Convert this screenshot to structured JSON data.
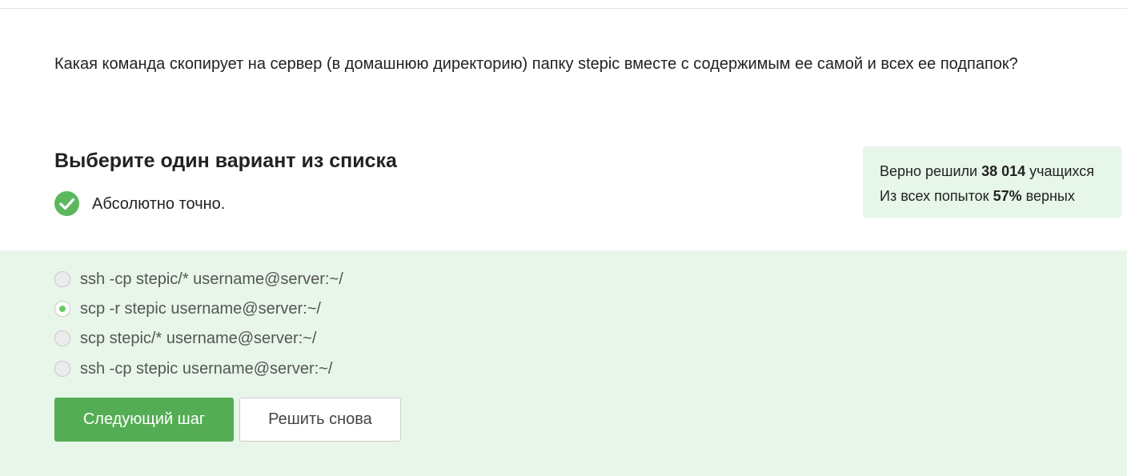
{
  "question": {
    "text": "Какая команда скопирует на сервер (в домашнюю директорию) папку stepic вместе с содержимым ее самой и всех ее подпапок?"
  },
  "instruction": "Выберите один вариант из списка",
  "feedback": {
    "text": "Абсолютно точно.",
    "icon": "check-circle-icon",
    "color": "#5cb85c"
  },
  "stats": {
    "solved_prefix": "Верно решили",
    "solved_count": "38 014",
    "solved_suffix": "учащихся",
    "attempts_prefix": "Из всех попыток",
    "attempts_percent": "57%",
    "attempts_suffix": "верных"
  },
  "options": [
    {
      "label": "ssh -cp stepic/* username@server:~/",
      "selected": false
    },
    {
      "label": "scp -r stepic username@server:~/",
      "selected": true
    },
    {
      "label": "scp stepic/* username@server:~/",
      "selected": false
    },
    {
      "label": "ssh -cp stepic username@server:~/",
      "selected": false
    }
  ],
  "buttons": {
    "next": "Следующий шаг",
    "retry": "Решить снова"
  },
  "colors": {
    "accent": "#54ad54",
    "answer_background": "#e7f6e9",
    "stats_background": "#e6f6e8",
    "radio_selected": "#66cc66"
  }
}
